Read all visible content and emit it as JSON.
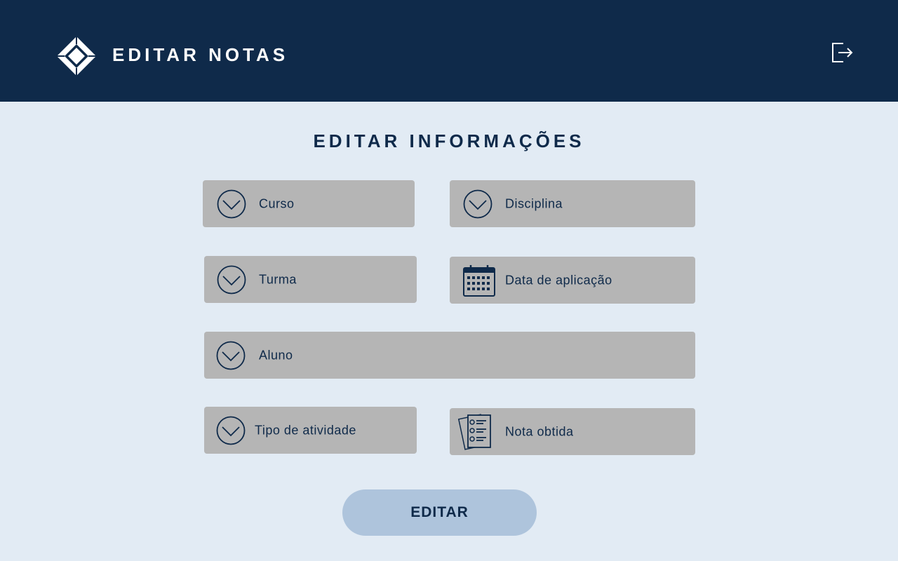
{
  "header": {
    "title": "EDITAR NOTAS",
    "logo_icon": "diamond-logo-icon",
    "logout_icon": "logout-icon"
  },
  "form": {
    "title": "EDITAR INFORMAÇÕES",
    "fields": {
      "curso": {
        "label": "Curso",
        "icon": "chevron-down-circle-icon"
      },
      "disciplina": {
        "label": "Disciplina",
        "icon": "chevron-down-circle-icon"
      },
      "turma": {
        "label": "Turma",
        "icon": "chevron-down-circle-icon"
      },
      "data_aplicacao": {
        "label": "Data de aplicação",
        "icon": "calendar-icon"
      },
      "aluno": {
        "label": "Aluno",
        "icon": "chevron-down-circle-icon"
      },
      "tipo_atividade": {
        "label": "Tipo de atividade",
        "icon": "chevron-down-circle-icon"
      },
      "nota_obtida": {
        "label": "Nota obtida",
        "icon": "checklist-icon"
      }
    },
    "submit_label": "EDITAR"
  },
  "colors": {
    "header_bg": "#0f2a4a",
    "page_bg": "#e2ebf4",
    "field_bg": "#b5b5b5",
    "button_bg": "#aec4dc",
    "text_dark": "#0f2a4a"
  }
}
